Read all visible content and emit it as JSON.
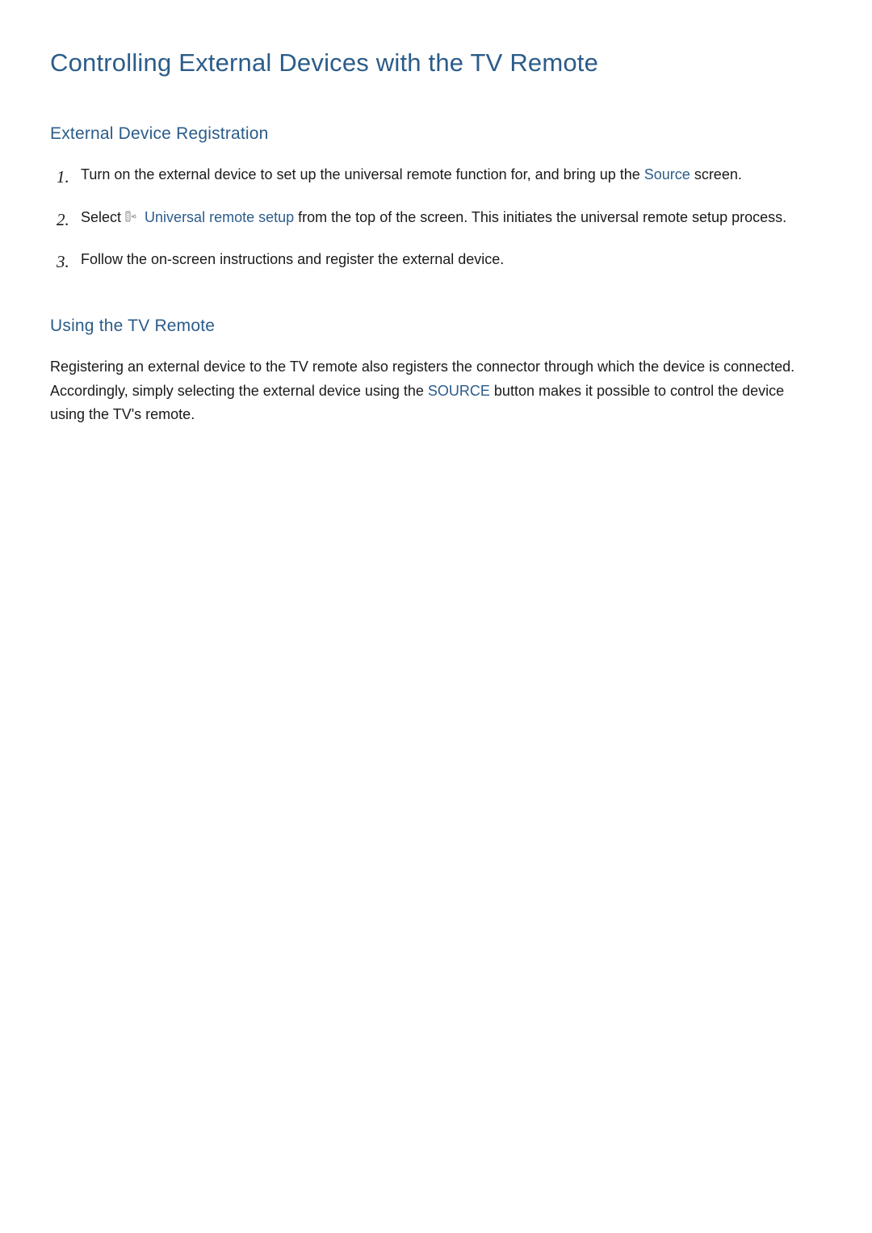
{
  "title": "Controlling External Devices with the TV Remote",
  "section1": {
    "heading": "External Device Registration",
    "items": [
      {
        "num": "1.",
        "pre": "Turn on the external device to set up the universal remote function for, and bring up the ",
        "highlight": "Source",
        "post": " screen."
      },
      {
        "num": "2.",
        "pre": "Select ",
        "highlight": "Universal remote setup",
        "post": " from the top of the screen. This initiates the universal remote setup process.",
        "hasIcon": true
      },
      {
        "num": "3.",
        "text": "Follow the on-screen instructions and register the external device."
      }
    ]
  },
  "section2": {
    "heading": "Using the TV Remote",
    "para_pre": "Registering an external device to the TV remote also registers the connector through which the device is connected. Accordingly, simply selecting the external device using the ",
    "para_highlight": "SOURCE",
    "para_post": " button makes it possible to control the device using the TV's remote."
  }
}
